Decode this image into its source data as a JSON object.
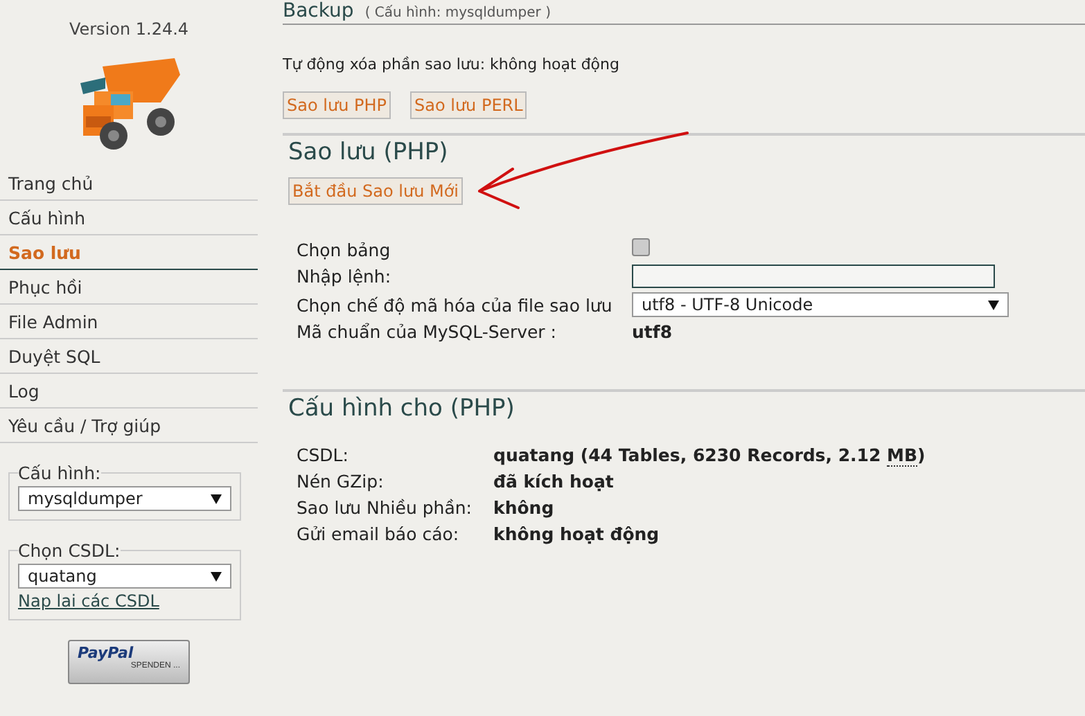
{
  "sidebar": {
    "version": "Version 1.24.4",
    "nav": [
      {
        "label": "Trang chủ",
        "selected": false
      },
      {
        "label": "Cấu hình",
        "selected": false
      },
      {
        "label": "Sao lưu",
        "selected": true
      },
      {
        "label": "Phục hồi",
        "selected": false
      },
      {
        "label": "File Admin",
        "selected": false
      },
      {
        "label": "Duyệt SQL",
        "selected": false
      },
      {
        "label": "Log",
        "selected": false
      },
      {
        "label": "Yêu cầu / Trợ giúp",
        "selected": false
      }
    ],
    "config_box": {
      "legend": "Cấu hình:",
      "value": "mysqldumper"
    },
    "db_box": {
      "legend": "Chọn CSDL:",
      "value": "quatang",
      "link": "Nap lai các CSDL"
    },
    "paypal": {
      "brand": "PayPal",
      "caption": "SPENDEN ..."
    }
  },
  "header": {
    "title": "Backup",
    "subtitle": "( Cấu hình: mysqldumper )"
  },
  "auto_delete": "Tự động xóa phần sao lưu: không hoạt động",
  "mode_buttons": [
    "Sao lưu PHP",
    "Sao lưu PERL"
  ],
  "backup_section": {
    "heading": "Sao lưu (PHP)",
    "start_button": "Bắt đầu Sao lưu Mới",
    "rows": [
      {
        "kind": "checkbox",
        "label": "Chọn bảng",
        "checked": false
      },
      {
        "kind": "input",
        "label": "Nhập lệnh:"
      },
      {
        "kind": "select",
        "label": "Chọn chế độ mã hóa của file sao lưu",
        "value": "utf8 - UTF-8 Unicode"
      },
      {
        "kind": "text",
        "label": "Mã chuẩn của MySQL-Server :",
        "value": "utf8"
      }
    ]
  },
  "config_section": {
    "heading": "Cấu hình cho (PHP)",
    "rows": [
      {
        "label": "CSDL:",
        "value": "quatang  (44 Tables, 6230 Records, 2.12 ",
        "unit": "MB",
        "suffix": ")"
      },
      {
        "label": "Nén GZip:",
        "value": "đã kích hoạt"
      },
      {
        "label": "Sao lưu Nhiều phần:",
        "value": "không"
      },
      {
        "label": "Gửi email báo cáo:",
        "value": "không hoạt động"
      }
    ]
  }
}
